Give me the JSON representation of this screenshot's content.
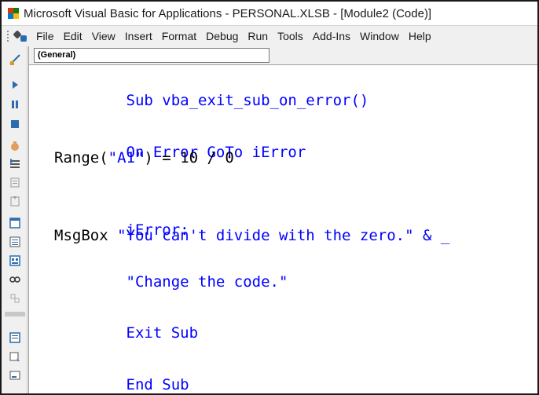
{
  "window": {
    "title": "Microsoft Visual Basic for Applications - PERSONAL.XLSB - [Module2 (Code)]"
  },
  "menubar": {
    "items": [
      "File",
      "Edit",
      "View",
      "Insert",
      "Format",
      "Debug",
      "Run",
      "Tools",
      "Add-Ins",
      "Window",
      "Help"
    ]
  },
  "code_window": {
    "object_combo": "(General)",
    "lines": [
      {
        "parts": [
          {
            "t": "Sub vba_exit_sub_on_error()",
            "c": "kw"
          }
        ]
      },
      {
        "parts": [
          {
            "t": "On Error GoTo iError",
            "c": "kw"
          }
        ]
      },
      {
        "parts": [
          {
            "t": "Range(",
            "c": "plain"
          },
          {
            "t": "\"A1\"",
            "c": "str"
          },
          {
            "t": ") = 10 / 0",
            "c": "plain"
          }
        ]
      },
      {
        "parts": [
          {
            "t": "iError:",
            "c": "kw"
          }
        ]
      },
      {
        "parts": [
          {
            "t": "MsgBox ",
            "c": "plain"
          },
          {
            "t": "\"You can't divide with the zero.\" & _",
            "c": "str"
          }
        ]
      },
      {
        "parts": [
          {
            "t": "\"Change the code.\"",
            "c": "str"
          }
        ]
      },
      {
        "parts": [
          {
            "t": "Exit Sub",
            "c": "kw"
          }
        ]
      },
      {
        "parts": [
          {
            "t": "End Sub",
            "c": "kw"
          }
        ]
      }
    ]
  },
  "colors": {
    "keyword": "#0000ff",
    "text": "#000000",
    "background": "#ffffff"
  }
}
